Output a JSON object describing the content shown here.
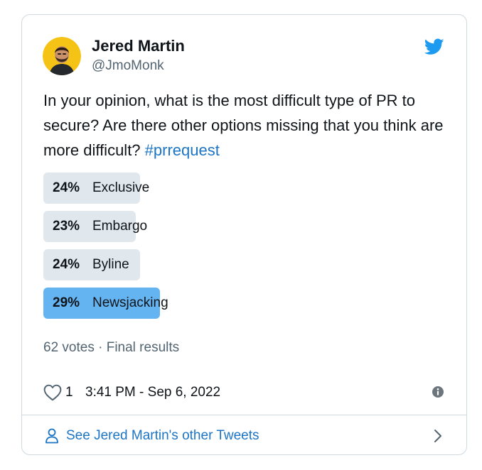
{
  "author": {
    "name": "Jered Martin",
    "handle": "@JmoMonk"
  },
  "tweet": {
    "text": "In your opinion, what is the most difficult type of PR to secure? Are there other options missing that you think are more difficult?",
    "hashtag": "#prrequest"
  },
  "poll": {
    "options": [
      {
        "percent_label": "24%",
        "label": "Exclusive",
        "percent": 24
      },
      {
        "percent_label": "23%",
        "label": "Embargo",
        "percent": 23
      },
      {
        "percent_label": "24%",
        "label": "Byline",
        "percent": 24
      },
      {
        "percent_label": "29%",
        "label": "Newsjacking",
        "percent": 29
      }
    ],
    "votes": "62 votes",
    "separator": "·",
    "status": "Final results"
  },
  "actions": {
    "like_count": "1",
    "timestamp": "3:41 PM - Sep 6, 2022"
  },
  "footer": {
    "link_text": "See Jered Martin's other Tweets"
  },
  "colors": {
    "link": "#1b74c4",
    "twitter_blue": "#1d9bf0",
    "poll_bar": "#e1e8ed",
    "poll_bar_winner": "#65b4f2",
    "muted_text": "#536471",
    "border": "#cfd9de"
  },
  "icons": {
    "brand": "twitter-bird-icon",
    "like": "heart-icon",
    "info": "info-icon",
    "profile": "person-icon",
    "navigate": "chevron-right-icon"
  }
}
